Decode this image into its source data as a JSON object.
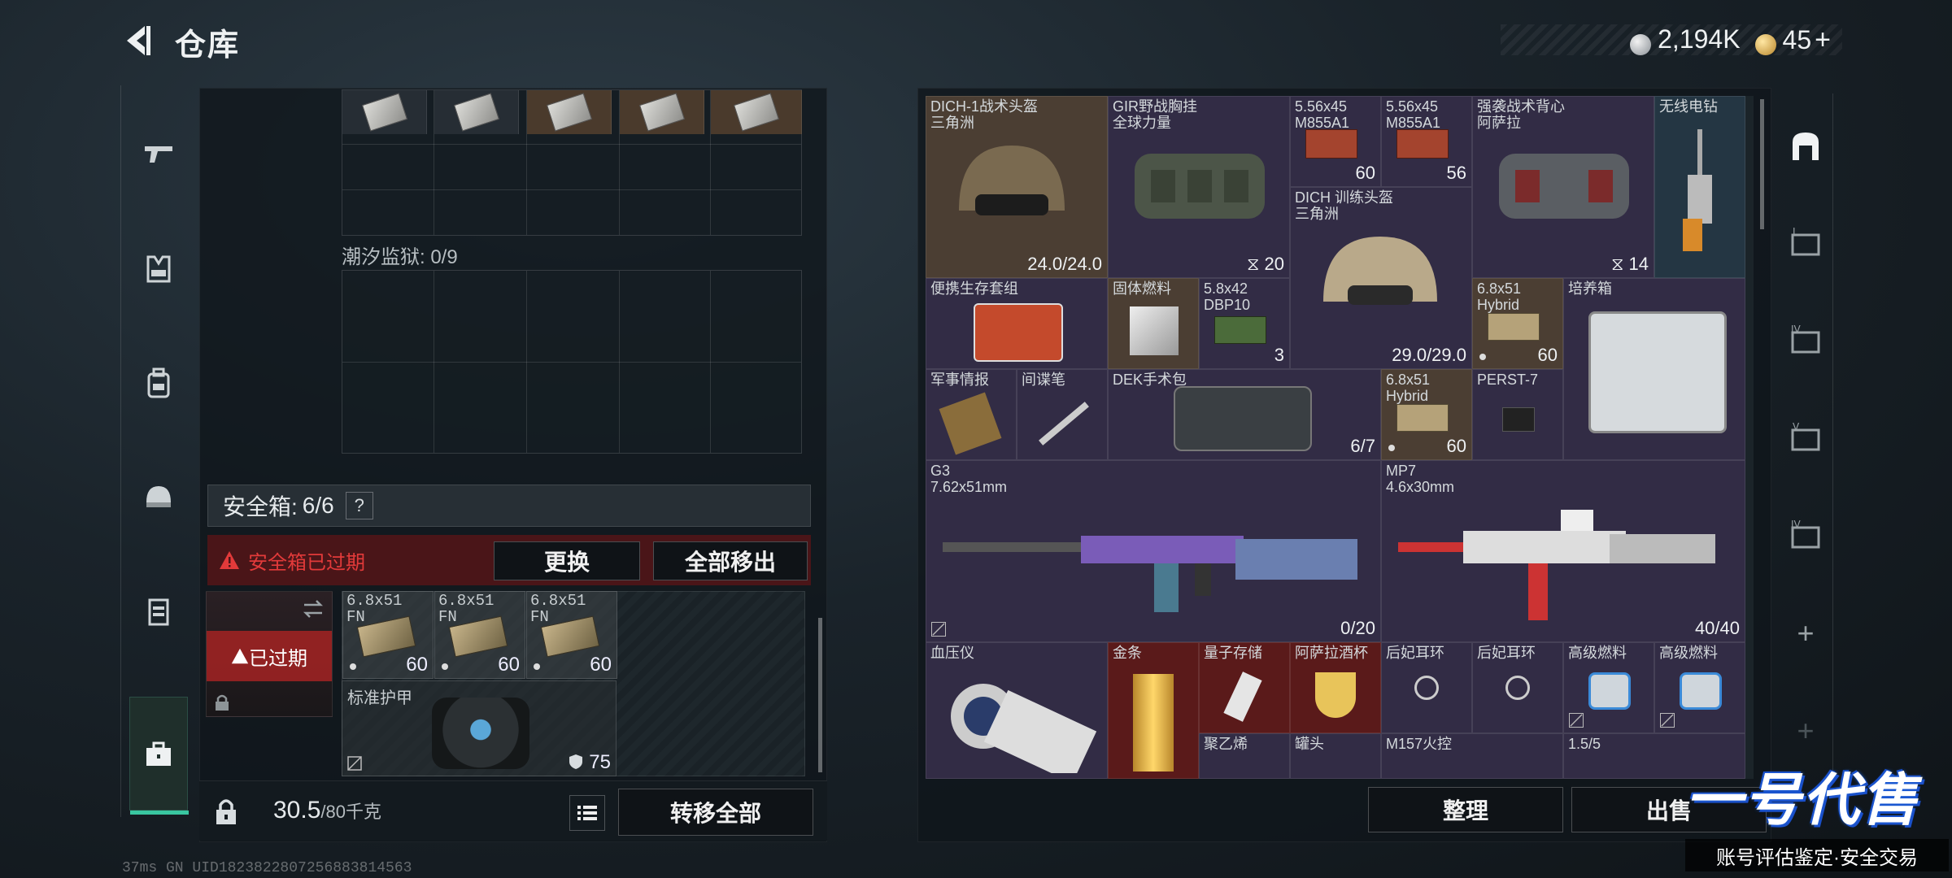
{
  "header": {
    "title": "仓库"
  },
  "currency": {
    "silver": "2,194K",
    "gold": "45",
    "add": "+"
  },
  "left_panel": {
    "prison_label": "潮汐监狱: 0/9",
    "safe": {
      "label": "安全箱:",
      "value": "6/6",
      "help": "?"
    },
    "expired": {
      "text": "安全箱已过期",
      "tag": "已过期"
    },
    "buttons": {
      "replace": "更换",
      "remove_all": "全部移出",
      "transfer_all": "转移全部"
    },
    "ammo": [
      {
        "name1": "6.8x51",
        "name2": "FN",
        "count": "60"
      },
      {
        "name1": "6.8x51",
        "name2": "FN",
        "count": "60"
      },
      {
        "name1": "6.8x51",
        "name2": "FN",
        "count": "60"
      }
    ],
    "armor": {
      "name": "标准护甲",
      "durability": "75"
    },
    "weight": {
      "current": "30.5",
      "max": "/80千克"
    }
  },
  "storage": {
    "items": [
      {
        "name": "DICH-1战术头盔",
        "sub": "三角洲",
        "val": "24.0/24.0"
      },
      {
        "name": "GIR野战胸挂",
        "sub": "全球力量",
        "val": "20"
      },
      {
        "name": "5.56x45",
        "sub": "M855A1",
        "val": "60"
      },
      {
        "name": "5.56x45",
        "sub": "M855A1",
        "val": "56"
      },
      {
        "name": "强袭战术背心",
        "sub": "阿萨拉",
        "val": "14"
      },
      {
        "name": "无线电钻",
        "sub": "",
        "val": ""
      },
      {
        "name": "DICH 训练头盔",
        "sub": "三角洲",
        "val": "29.0/29.0"
      },
      {
        "name": "便携生存套组",
        "sub": "",
        "val": ""
      },
      {
        "name": "固体燃料",
        "sub": "",
        "val": ""
      },
      {
        "name": "5.8x42",
        "sub": "DBP10",
        "val": "3"
      },
      {
        "name": "6.8x51",
        "sub": "Hybrid",
        "val": "60"
      },
      {
        "name": "培养箱",
        "sub": "",
        "val": ""
      },
      {
        "name": "军事情报",
        "sub": "",
        "val": ""
      },
      {
        "name": "间谍笔",
        "sub": "",
        "val": ""
      },
      {
        "name": "DEK手术包",
        "sub": "",
        "val": "6/7"
      },
      {
        "name": "6.8x51",
        "sub": "Hybrid",
        "val": "60"
      },
      {
        "name": "PERST-7",
        "sub": "",
        "val": ""
      },
      {
        "name": "G3",
        "sub": "7.62x51mm",
        "val": "0/20"
      },
      {
        "name": "MP7",
        "sub": "4.6x30mm",
        "val": "40/40"
      },
      {
        "name": "血压仪",
        "sub": "",
        "val": ""
      },
      {
        "name": "金条",
        "sub": "",
        "val": ""
      },
      {
        "name": "量子存储",
        "sub": "",
        "val": ""
      },
      {
        "name": "阿萨拉酒杯",
        "sub": "",
        "val": ""
      },
      {
        "name": "后妃耳环",
        "sub": "",
        "val": ""
      },
      {
        "name": "后妃耳环",
        "sub": "",
        "val": ""
      },
      {
        "name": "高级燃料",
        "sub": "",
        "val": ""
      },
      {
        "name": "高级燃料",
        "sub": "",
        "val": ""
      },
      {
        "name": "聚乙烯",
        "sub": "",
        "val": ""
      },
      {
        "name": "罐头",
        "sub": "",
        "val": ""
      },
      {
        "name": "M157火控",
        "sub": "",
        "val": ""
      },
      {
        "name": "1.5/5",
        "sub": "",
        "val": ""
      }
    ],
    "buttons": {
      "sort": "整理",
      "sell": "出售"
    }
  },
  "right_nav": {
    "tabs": [
      "",
      "I",
      "IV",
      "V",
      "IV"
    ],
    "add": "+"
  },
  "watermark": {
    "logo": "一号代售",
    "sub": "账号评估鉴定·安全交易"
  },
  "status": {
    "text": "37ms  GN UID1823822807256883814563"
  }
}
